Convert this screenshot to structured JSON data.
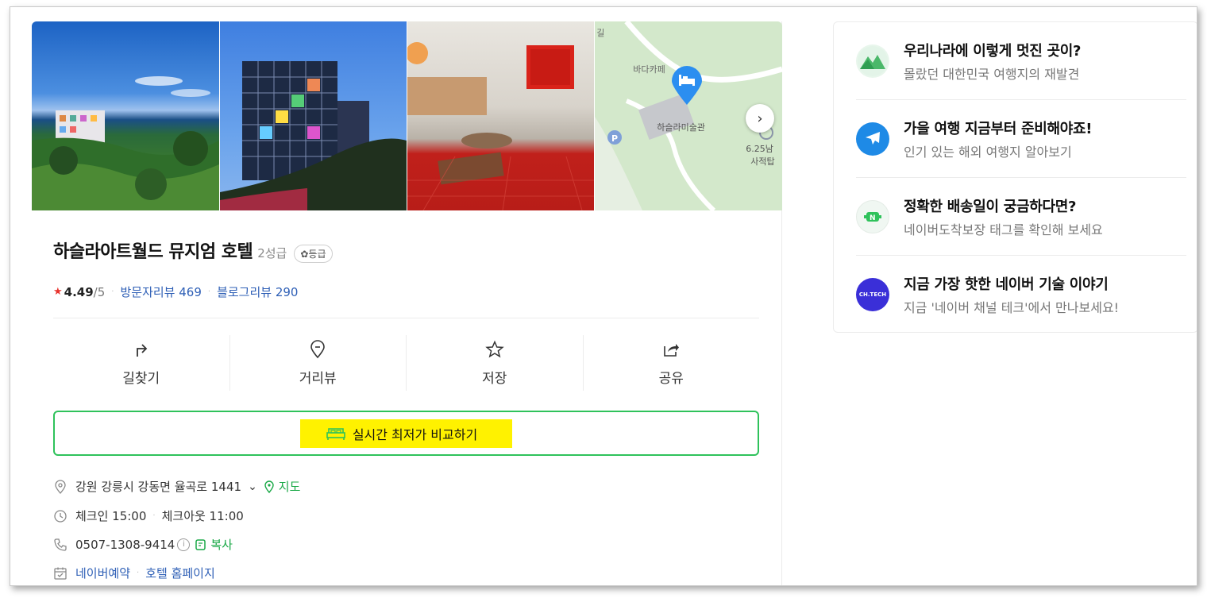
{
  "hotel": {
    "name": "하슬라아트월드 뮤지엄 호텔",
    "grade": "2성급",
    "grade_chip": "등급",
    "rating": "4.49",
    "rating_max": "/5",
    "visitor_reviews": "방문자리뷰 469",
    "blog_reviews": "블로그리뷰 290"
  },
  "gallery": {
    "map_labels": [
      "바다카페",
      "하슬라미술관",
      "6.25남",
      "사적탑",
      "길"
    ],
    "map_pin_icon": "hotel-bed-pin-icon",
    "next_icon": "chevron-right-icon"
  },
  "actions": [
    {
      "label": "길찾기",
      "icon": "directions-icon"
    },
    {
      "label": "거리뷰",
      "icon": "location-pin-icon"
    },
    {
      "label": "저장",
      "icon": "star-icon"
    },
    {
      "label": "공유",
      "icon": "share-icon"
    }
  ],
  "compare": {
    "label": "실시간 최저가 비교하기",
    "icon": "bed-icon"
  },
  "info": {
    "address": "강원 강릉시 강동면 율곡로 1441",
    "map_link": "지도",
    "hours": "체크인 15:00",
    "checkout": "체크아웃 11:00",
    "phone": "0507-1308-9414",
    "copy": "복사",
    "booking": "네이버예약",
    "homepage": "호텔 홈페이지"
  },
  "promos": [
    {
      "title": "우리나라에 이렇게 멋진 곳이?",
      "sub": "몰랐던 대한민국 여행지의 재발견",
      "icon": "mountain-icon"
    },
    {
      "title": "가을 여행 지금부터 준비해야죠!",
      "sub": "인기 있는 해외 여행지 알아보기",
      "icon": "airplane-icon"
    },
    {
      "title": "정확한 배송일이 궁금하다면?",
      "sub": "네이버도착보장 태그를 확인해 보세요",
      "icon": "delivery-icon"
    },
    {
      "title": "지금 가장 핫한 네이버 기술 이야기",
      "sub": "지금 '네이버 채널 테크'에서 만나보세요!",
      "icon": "ch-tech-icon",
      "icon_text": "CH.TECH"
    }
  ],
  "colors": {
    "green": "#2fc25b",
    "link_blue": "#2e5fb6",
    "highlight": "#fff200",
    "star_red": "#e8322c"
  }
}
